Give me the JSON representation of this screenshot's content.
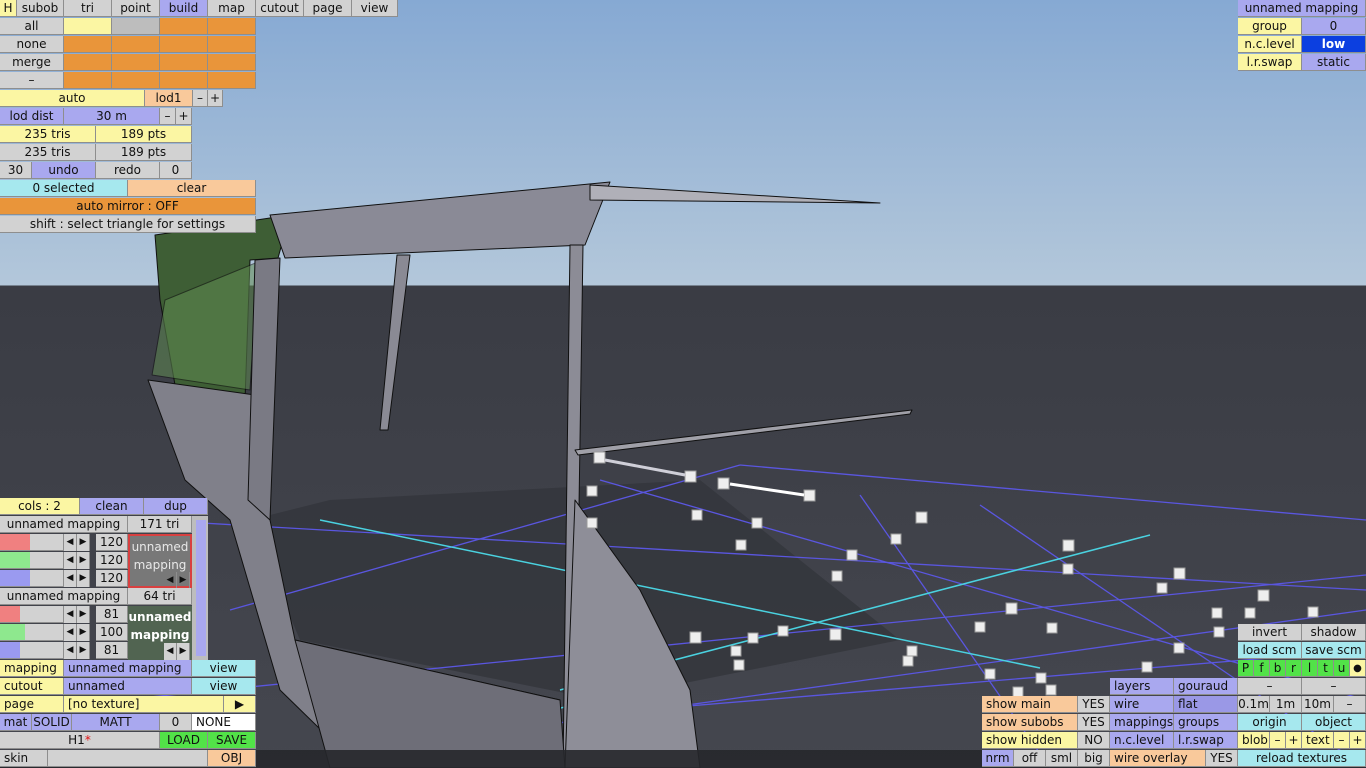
{
  "top_menu": {
    "hotkey": "H",
    "items": [
      "subob",
      "tri",
      "point",
      "build",
      "map",
      "cutout",
      "page",
      "view"
    ],
    "active": "build"
  },
  "select_rows": [
    "all",
    "none",
    "merge",
    "–"
  ],
  "lod": {
    "mode": "auto",
    "level": "lod1",
    "minus": "–",
    "plus": "+",
    "dist_label": "lod dist",
    "dist_value": "30 m"
  },
  "stats": {
    "tris_a": "235 tris",
    "pts_a": "189 pts",
    "tris_b": "235 tris",
    "pts_b": "189 pts"
  },
  "history": {
    "count": "30",
    "undo": "undo",
    "redo": "redo",
    "redo_count": "0"
  },
  "selection": {
    "count": "0 selected",
    "clear": "clear",
    "auto_mirror": "auto mirror : OFF",
    "hint": "shift : select triangle for settings"
  },
  "top_right": {
    "mapping_title": "unnamed mapping",
    "group_label": "group",
    "group_value": "0",
    "nclevel_label": "n.c.level",
    "nclevel_value": "low",
    "lrswap_label": "l.r.swap",
    "lrswap_value": "static"
  },
  "cols_panel": {
    "cols": "cols : 2",
    "clean": "clean",
    "dup": "dup"
  },
  "mapping1": {
    "name": "unnamed mapping",
    "tris": "171 tri",
    "r": "120",
    "g": "120",
    "b": "120",
    "swatch_text": "unnamed mapping",
    "r_level": 0.47,
    "g_level": 0.47,
    "b_level": 0.47,
    "swatch_color": "#787878"
  },
  "mapping2": {
    "name": "unnamed mapping",
    "tris": "64 tri",
    "r": "81",
    "g": "100",
    "b": "81",
    "swatch_text": "unnamed mapping",
    "r_level": 0.32,
    "g_level": 0.39,
    "b_level": 0.32,
    "swatch_color": "#516451"
  },
  "arrows": {
    "left": "◀",
    "right": "▶"
  },
  "props": {
    "mapping_label": "mapping",
    "mapping_value": "unnamed mapping",
    "view1": "view",
    "cutout_label": "cutout",
    "cutout_value": "unnamed",
    "view2": "view",
    "page_label": "page",
    "page_value": "[no texture]",
    "play": "▶",
    "mat": "mat",
    "solid": "SOLID",
    "matt": "MATT",
    "mat_num": "0",
    "mat_none": "NONE",
    "file_name": "H1",
    "file_mark": "*",
    "load": "LOAD",
    "save": "SAVE",
    "skin": "skin",
    "obj": "OBJ"
  },
  "bottom_right": {
    "invert": "invert",
    "shadow": "shadow",
    "load_scm": "load scm",
    "save_scm": "save scm",
    "flags": [
      "P",
      "f",
      "b",
      "r",
      "l",
      "t",
      "u"
    ],
    "dot": "●",
    "dash1": "–",
    "dash2": "–",
    "show_main": "show main",
    "show_main_v": "YES",
    "show_subobs": "show subobs",
    "show_subobs_v": "YES",
    "show_hidden": "show hidden",
    "show_hidden_v": "NO",
    "layers": "layers",
    "gouraud": "gouraud",
    "wire": "wire",
    "flat": "flat",
    "mappings": "mappings",
    "groups": "groups",
    "nclevel": "n.c.level",
    "lrswap": "l.r.swap",
    "s1": "0.1m",
    "s2": "1m",
    "s3": "10m",
    "s_minus": "–",
    "origin": "origin",
    "object": "object",
    "blob": "blob",
    "text": "text",
    "minus": "–",
    "plus": "+",
    "nrm": "nrm",
    "off": "off",
    "sml": "sml",
    "big": "big",
    "wire_overlay": "wire overlay",
    "wire_overlay_v": "YES",
    "reload": "reload textures"
  }
}
